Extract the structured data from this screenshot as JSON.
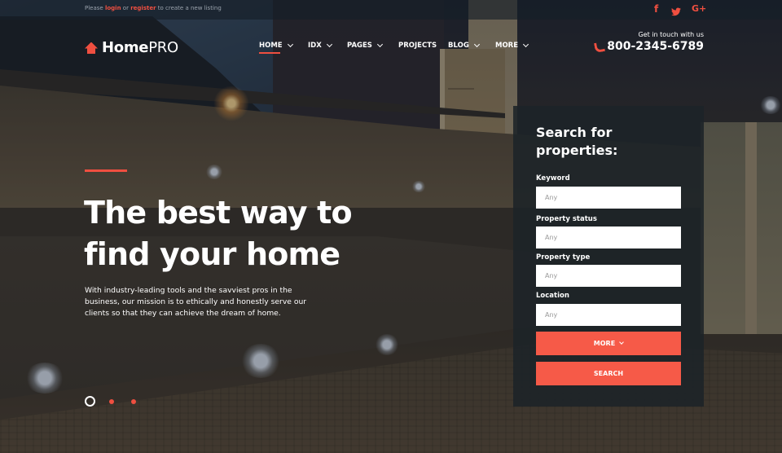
{
  "topbar": {
    "prefix": "Please",
    "login_label": "login",
    "or": "or",
    "register_label": "register",
    "suffix": "to create a new listing",
    "social": [
      {
        "icon": "facebook-icon",
        "glyph": "f"
      },
      {
        "icon": "twitter-icon",
        "glyph": "🐦"
      },
      {
        "icon": "google-plus-icon",
        "glyph": "G+"
      }
    ]
  },
  "header": {
    "logo_bold": "Home",
    "logo_light": "PRO",
    "nav": [
      {
        "label": "HOME",
        "has_dropdown": true,
        "active": true
      },
      {
        "label": "IDX",
        "has_dropdown": true
      },
      {
        "label": "PAGES",
        "has_dropdown": true
      },
      {
        "label": "PROJECTS",
        "has_dropdown": false
      },
      {
        "label": "BLOG",
        "has_dropdown": true
      },
      {
        "label": "MORE",
        "has_dropdown": true
      }
    ],
    "contact_label": "Get in touch with us",
    "phone": "800-2345-6789"
  },
  "hero": {
    "title_line1": "The best way to",
    "title_line2": "find your home",
    "description": "With industry-leading tools and the savviest pros in the business, our mission is to ethically and honestly serve our clients so that they can achieve the dream of home.",
    "slides": {
      "count": 3,
      "active": 1
    }
  },
  "search": {
    "title": "Search for properties:",
    "fields": [
      {
        "label": "Keyword",
        "placeholder": "Any"
      },
      {
        "label": "Property status",
        "placeholder": "Any"
      },
      {
        "label": "Property type",
        "placeholder": "Any"
      },
      {
        "label": "Location",
        "placeholder": "Any"
      }
    ],
    "more_label": "MORE",
    "search_label": "SEARCH"
  },
  "colors": {
    "accent": "#ef4f40",
    "button": "#f65a48",
    "panel": "#1c2328"
  }
}
